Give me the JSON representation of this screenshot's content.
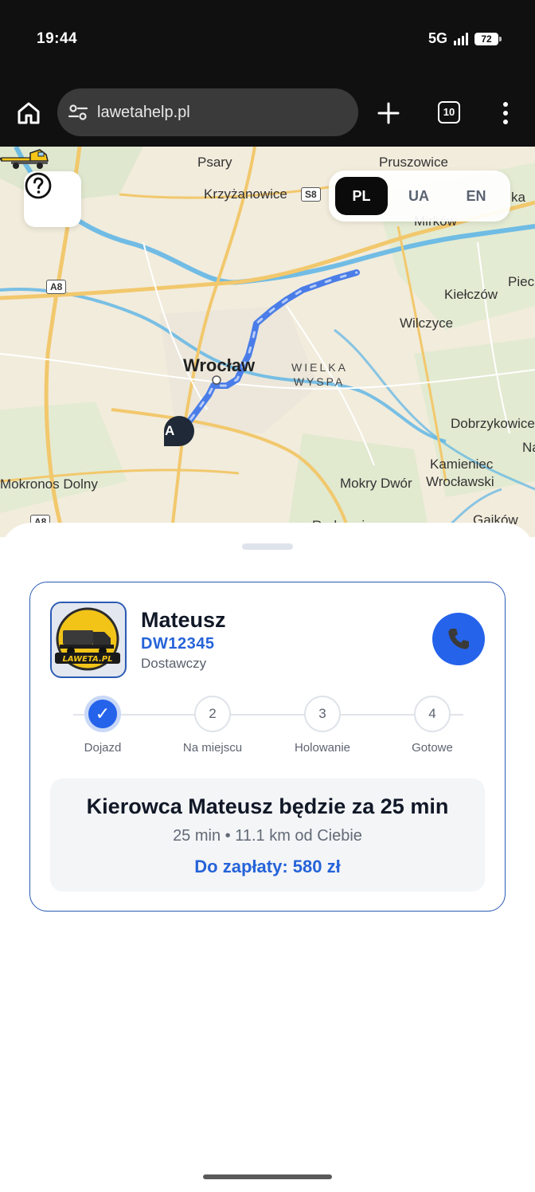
{
  "status_bar": {
    "time": "19:44",
    "network": "5G",
    "battery": "72"
  },
  "browser": {
    "url": "lawetahelp.pl",
    "tab_count": "10",
    "icons": [
      "home-icon",
      "tune-icon",
      "plus-icon",
      "tabs-icon",
      "more-vert-icon"
    ]
  },
  "map": {
    "labels": {
      "psary": "Psary",
      "pruszowice": "Pruszowice",
      "krzyzanowice": "Krzyżanowice",
      "mirkow": "Mirków",
      "pieciu": "Piec",
      "kielczow": "Kiełczów",
      "wilczyce": "Wilczyce",
      "wroclaw": "Wrocław",
      "wielka_wyspa": "WIELKA WYSPA",
      "dobrzykowice": "Dobrzykowice",
      "na": "Na",
      "mokronos": "Mokronos Dolny",
      "kamieniec": "Kamieniec",
      "wroclawski": "Wrocławski",
      "mokry_dwor": "Mokry Dwór",
      "gajkow": "Gajków",
      "radwanice": "Radwanice",
      "ka": "ka"
    },
    "road_shields": {
      "s8": "S8",
      "a8_top": "A8",
      "a8_bottom": "A8"
    },
    "marker_label": "A",
    "languages": [
      {
        "code": "PL",
        "active": true
      },
      {
        "code": "UA",
        "active": false
      },
      {
        "code": "EN",
        "active": false
      }
    ]
  },
  "driver": {
    "name": "Mateusz",
    "plate": "DW12345",
    "vehicle_type": "Dostawczy",
    "avatar_text": "LAWETA.PL"
  },
  "steps": [
    {
      "number": "1",
      "label": "Dojazd",
      "done": true
    },
    {
      "number": "2",
      "label": "Na miejscu",
      "done": false
    },
    {
      "number": "3",
      "label": "Holowanie",
      "done": false
    },
    {
      "number": "4",
      "label": "Gotowe",
      "done": false
    }
  ],
  "eta": {
    "title": "Kierowca Mateusz będzie za 25 min",
    "subtitle": "25 min • 11.1 km od Ciebie",
    "price": "Do zapłaty: 580 zł"
  },
  "colors": {
    "accent": "#2563eb",
    "route": "#4a7de8",
    "map_background": "#f2ecdc",
    "river": "#5ab4e6"
  }
}
